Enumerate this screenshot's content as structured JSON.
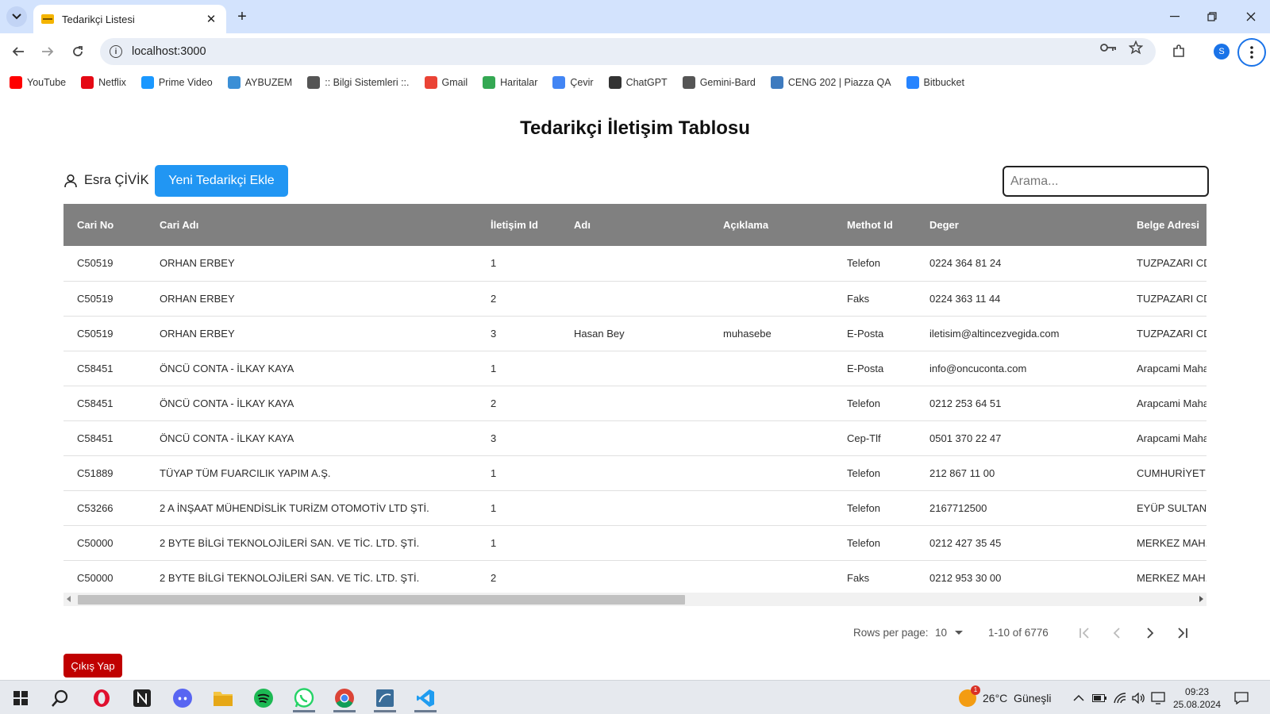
{
  "browser": {
    "tab_title": "Tedarikçi Listesi",
    "tab_close": "✕",
    "new_tab": "+",
    "url": "localhost:3000",
    "profile_initial": "S",
    "bookmarks": [
      {
        "label": "YouTube",
        "icon": "youtube-icon",
        "color": "#ff0000"
      },
      {
        "label": "Netflix",
        "icon": "netflix-icon",
        "color": "#e50914"
      },
      {
        "label": "Prime Video",
        "icon": "prime-video-icon",
        "color": "#1a98ff"
      },
      {
        "label": "AYBUZEM",
        "icon": "aybuzem-icon",
        "color": "#3b8fd6"
      },
      {
        "label": ":: Bilgi Sistemleri ::.",
        "icon": "globe-icon",
        "color": "#555555"
      },
      {
        "label": "Gmail",
        "icon": "gmail-icon",
        "color": "#ea4335"
      },
      {
        "label": "Haritalar",
        "icon": "maps-icon",
        "color": "#34a853"
      },
      {
        "label": "Çevir",
        "icon": "translate-icon",
        "color": "#4285f4"
      },
      {
        "label": "ChatGPT",
        "icon": "chatgpt-icon",
        "color": "#333333"
      },
      {
        "label": "Gemini-Bard",
        "icon": "globe-icon",
        "color": "#555555"
      },
      {
        "label": "CENG 202 | Piazza QA",
        "icon": "piazza-icon",
        "color": "#3e7bbf"
      },
      {
        "label": "Bitbucket",
        "icon": "bitbucket-icon",
        "color": "#2684ff"
      }
    ]
  },
  "page": {
    "title": "Tedarikçi İletişim Tablosu",
    "user_name": "Esra ÇİVİK",
    "add_button": "Yeni Tedarikçi Ekle",
    "search_placeholder": "Arama...",
    "logout_button": "Çıkış Yap"
  },
  "table": {
    "headers": [
      "Cari No",
      "Cari Adı",
      "İletişim Id",
      "Adı",
      "Açıklama",
      "Methot Id",
      "Deger",
      "Belge Adresi"
    ],
    "rows": [
      [
        "C50519",
        "ORHAN ERBEY",
        "1",
        "",
        "",
        "Telefon",
        "0224 364 81 24",
        "TUZPAZARI CD"
      ],
      [
        "C50519",
        "ORHAN ERBEY",
        "2",
        "",
        "",
        "Faks",
        "0224 363 11 44",
        "TUZPAZARI CD"
      ],
      [
        "C50519",
        "ORHAN ERBEY",
        "3",
        "Hasan Bey",
        "muhasebe",
        "E-Posta",
        "iletisim@altincezvegida.com",
        "TUZPAZARI CD"
      ],
      [
        "C58451",
        "ÖNCÜ CONTA - İLKAY KAYA",
        "1",
        "",
        "",
        "E-Posta",
        "info@oncuconta.com",
        "Arapcami Maha"
      ],
      [
        "C58451",
        "ÖNCÜ CONTA - İLKAY KAYA",
        "2",
        "",
        "",
        "Telefon",
        "0212 253 64 51",
        "Arapcami Maha"
      ],
      [
        "C58451",
        "ÖNCÜ CONTA - İLKAY KAYA",
        "3",
        "",
        "",
        "Cep-Tlf",
        "0501 370 22 47",
        "Arapcami Maha"
      ],
      [
        "C51889",
        "TÜYAP TÜM FUARCILIK YAPIM A.Ş.",
        "1",
        "",
        "",
        "Telefon",
        "212 867 11 00",
        "CUMHURİYET M"
      ],
      [
        "C53266",
        "2 A İNŞAAT MÜHENDİSLİK TURİZM OTOMOTİV LTD ŞTİ.",
        "1",
        "",
        "",
        "Telefon",
        "2167712500",
        "EYÜP SULTAN M"
      ],
      [
        "C50000",
        "2 BYTE BİLGİ TEKNOLOJİLERİ SAN. VE TİC. LTD. ŞTİ.",
        "1",
        "",
        "",
        "Telefon",
        "0212 427 35 45",
        "MERKEZ MAH."
      ],
      [
        "C50000",
        "2 BYTE BİLGİ TEKNOLOJİLERİ SAN. VE TİC. LTD. ŞTİ.",
        "2",
        "",
        "",
        "Faks",
        "0212 953 30 00",
        "MERKEZ MAH."
      ]
    ]
  },
  "pagination": {
    "rows_per_page_label": "Rows per page:",
    "rows_per_page_value": "10",
    "range_label": "1-10 of 6776"
  },
  "taskbar": {
    "weather": "26°C  Güneşli",
    "weather_badge": "1",
    "time": "09:23",
    "date": "25.08.2024"
  },
  "colors": {
    "accent": "#2196f3",
    "table_header": "#808080",
    "logout": "#c00000"
  }
}
